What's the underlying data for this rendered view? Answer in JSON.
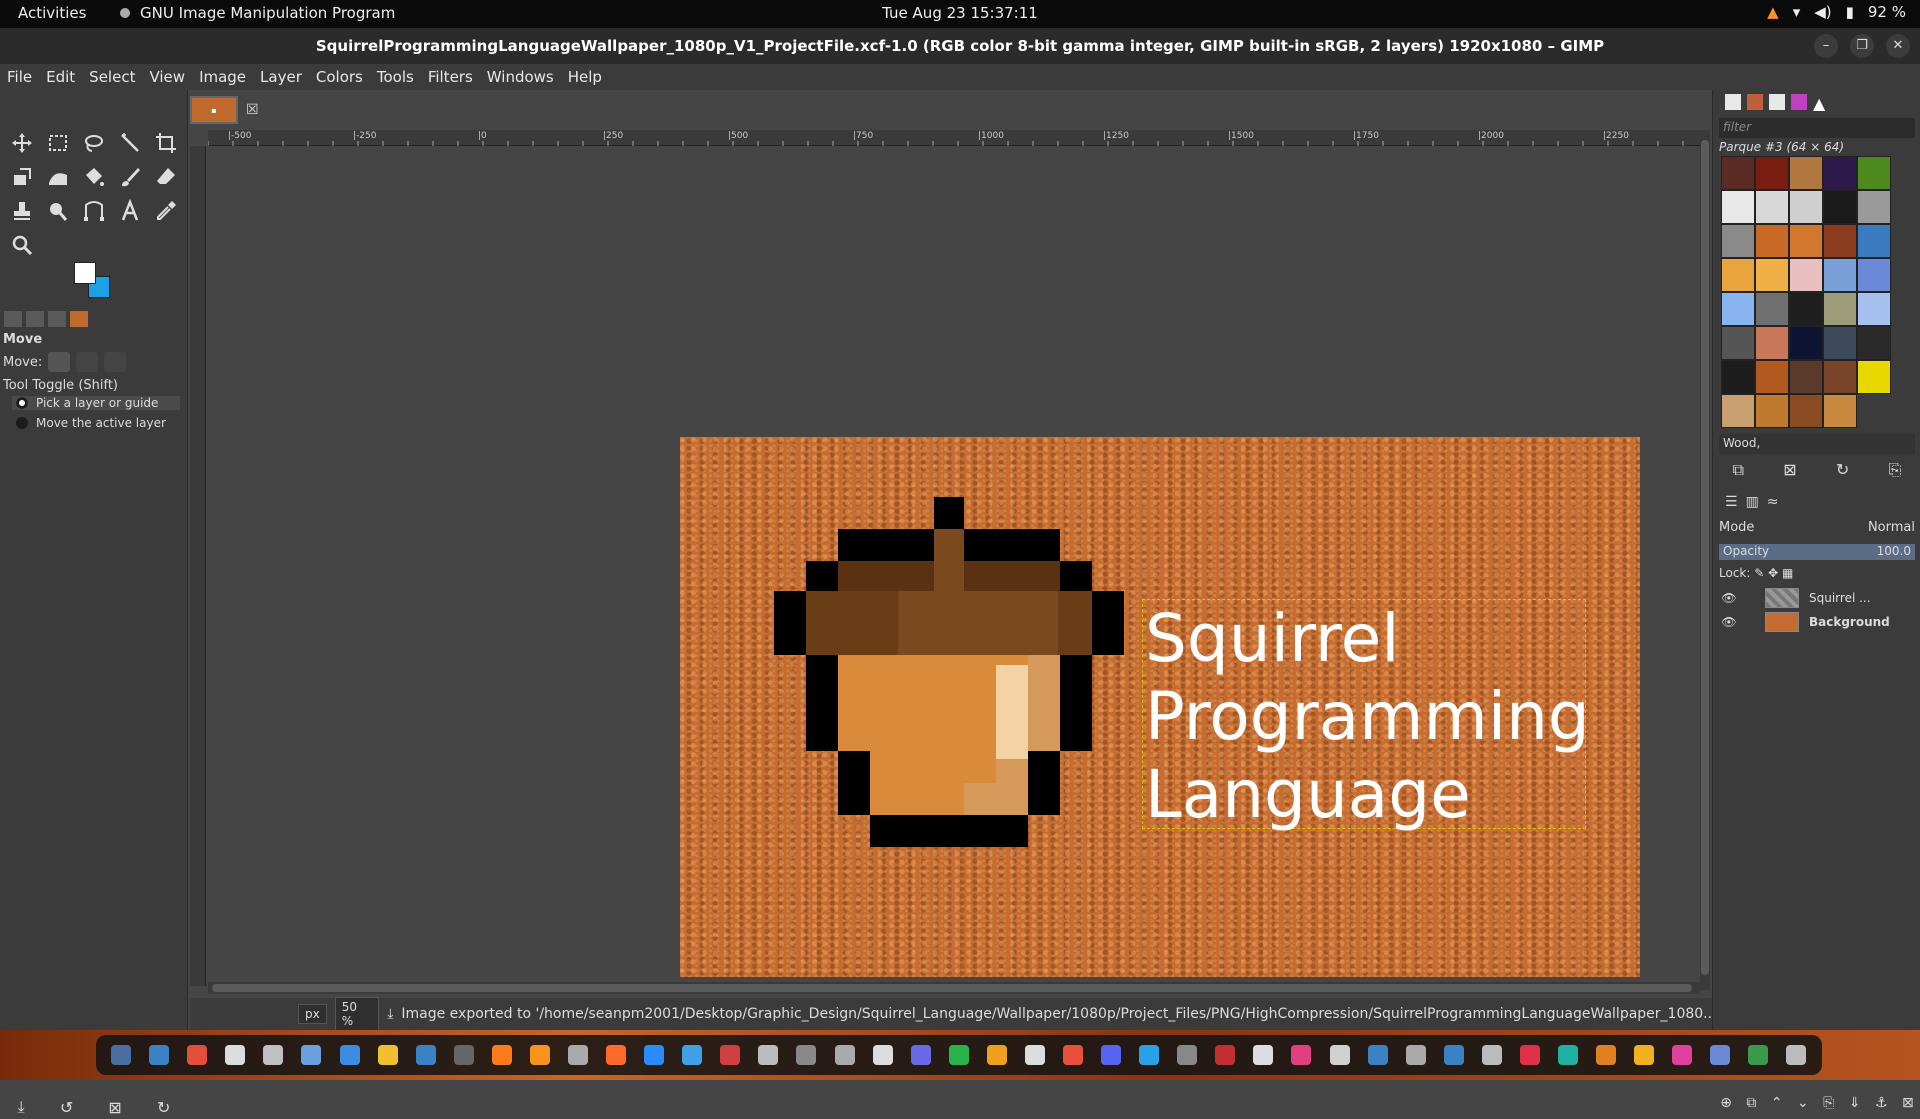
{
  "topbar": {
    "activities": "Activities",
    "app_name": "GNU Image Manipulation Program",
    "clock": "Tue Aug 23  15:37:11",
    "battery": "92 %"
  },
  "window": {
    "title": "SquirrelProgrammingLanguageWallpaper_1080p_V1_ProjectFile.xcf-1.0 (RGB color 8-bit gamma integer, GIMP built-in sRGB, 2 layers) 1920x1080 – GIMP"
  },
  "menu": [
    "File",
    "Edit",
    "Select",
    "View",
    "Image",
    "Layer",
    "Colors",
    "Tools",
    "Filters",
    "Windows",
    "Help"
  ],
  "tool_options": {
    "title": "Move",
    "move_label": "Move:",
    "toggle": "Tool Toggle  (Shift)",
    "option1": "Pick a layer or guide",
    "option2": "Move the active layer"
  },
  "ruler": {
    "labels": [
      "|-500",
      "|-250",
      "|0",
      "|250",
      "|500",
      "|750",
      "|1000",
      "|1250",
      "|1500",
      "|1750",
      "|2000",
      "|2250"
    ]
  },
  "image_text": {
    "line1": "Squirrel",
    "line2": "Programming",
    "line3": "Language"
  },
  "status": {
    "unit": "px",
    "zoom": "50 %",
    "message": "Image exported to '/home/seanpm2001/Desktop/Graphic_Design/Squirrel_Language/Wallpaper/1080p/Project_Files/PNG/HighCompression/SquirrelProgrammingLanguageWallpaper_1080..."
  },
  "patterns": {
    "filter_placeholder": "filter",
    "current": "Parque #3 (64 × 64)",
    "tag": "Wood,",
    "colors": [
      "#5a2a25",
      "#7a1e12",
      "#b27640",
      "#2e1a4a",
      "#4d8a1e",
      "#e8e8e8",
      "#d8d8d8",
      "#cfcfcf",
      "#1a1a1a",
      "#9a9a9a",
      "#8a8a8a",
      "#c86a26",
      "#d0782e",
      "#8c3c1e",
      "#3a7abf",
      "#e9a43e",
      "#f0b045",
      "#e8c0c0",
      "#7aa0d8",
      "#6a8ad8",
      "#8ab4f0",
      "#707070",
      "#1e1e1e",
      "#9c9c7a",
      "#a8c0f0",
      "#555555",
      "#c87858",
      "#0e1434",
      "#3c4a5c",
      "#2a2a2a",
      "#1c1c1c",
      "#b05a20",
      "#5a3a2a",
      "#7a4428",
      "#e8d800",
      "#c8a070",
      "#c07a30",
      "#8a4a22",
      "#c88a40"
    ]
  },
  "layers": {
    "mode_label": "Mode",
    "mode_value": "Normal",
    "opacity_label": "Opacity",
    "opacity_value": "100.0",
    "lock_label": "Lock:",
    "items": [
      {
        "name": "Squirrel ..."
      },
      {
        "name": "Background"
      }
    ]
  },
  "colors": {
    "fg": "#ffffff",
    "bg": "#1ea0e6",
    "image_bg": "#c46c32"
  }
}
